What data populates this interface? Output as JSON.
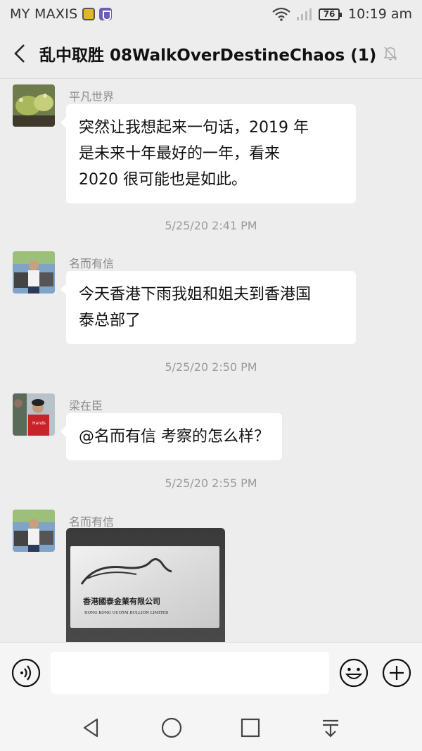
{
  "status_bar": {
    "carrier": "MY MAXIS",
    "battery": "76",
    "time": "10:19 am"
  },
  "header": {
    "title": "乱中取胜 08WalkOverDestineChaos (1)"
  },
  "messages": [
    {
      "sender": "平凡世界",
      "text_lines": [
        "突然让我想起来一句话，2019 年",
        "是未来十年最好的一年，看来",
        "2020 很可能也是如此。"
      ]
    },
    {
      "timestamp": "5/25/20 2:41 PM"
    },
    {
      "sender": "名而有信",
      "text_lines": [
        "今天香港下雨我姐和姐夫到香港国",
        "泰总部了"
      ]
    },
    {
      "timestamp": "5/25/20 2:50 PM"
    },
    {
      "sender": "梁在臣",
      "text_lines": [
        "@名而有信 考察的怎么样？"
      ]
    },
    {
      "timestamp": "5/25/20 2:55 PM"
    },
    {
      "sender": "名而有信",
      "image": {
        "sign_line1": "香港國泰金業有限公司",
        "sign_line2": "HONG KONG GUOTAI BULLION LIMITED"
      }
    }
  ],
  "input_bar": {
    "placeholder": "",
    "icons": [
      "voice-icon",
      "emoji-icon",
      "plus-icon"
    ]
  },
  "nav_bar": {
    "icons": [
      "back-triangle-icon",
      "home-circle-icon",
      "recents-square-icon",
      "notification-pull-icon"
    ]
  }
}
